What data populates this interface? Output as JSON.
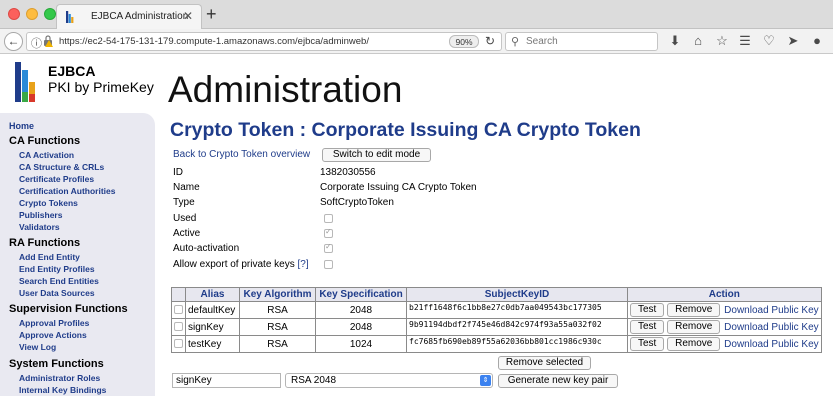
{
  "browser": {
    "tab_title": "EJBCA Administration",
    "tab_close": "✕",
    "new_tab": "+",
    "url": "https://ec2-54-175-131-179.compute-1.amazonaws.com/ejbca/adminweb/",
    "zoom": "90%",
    "search_placeholder": "Search"
  },
  "logo": {
    "title": "EJBCA",
    "subtitle": "PKI by PrimeKey"
  },
  "page_heading": "Administration",
  "sidebar": {
    "home": "Home",
    "sections": [
      {
        "title": "CA Functions",
        "items": [
          "CA Activation",
          "CA Structure & CRLs",
          "Certificate Profiles",
          "Certification Authorities",
          "Crypto Tokens",
          "Publishers",
          "Validators"
        ]
      },
      {
        "title": "RA Functions",
        "items": [
          "Add End Entity",
          "End Entity Profiles",
          "Search End Entities",
          "User Data Sources"
        ]
      },
      {
        "title": "Supervision Functions",
        "items": [
          "Approval Profiles",
          "Approve Actions",
          "View Log"
        ]
      },
      {
        "title": "System Functions",
        "items": [
          "Administrator Roles",
          "Internal Key Bindings"
        ]
      }
    ]
  },
  "crypto_token": {
    "title": "Crypto Token : Corporate Issuing CA Crypto Token",
    "back_link": "Back to Crypto Token overview",
    "edit_button": "Switch to edit mode",
    "fields": {
      "id_label": "ID",
      "id_value": "1382030556",
      "name_label": "Name",
      "name_value": "Corporate Issuing CA Crypto Token",
      "type_label": "Type",
      "type_value": "SoftCryptoToken",
      "used_label": "Used",
      "active_label": "Active",
      "autoactivation_label": "Auto-activation",
      "export_label": "Allow export of private keys",
      "export_help": "[?]"
    },
    "checkbox_states": {
      "used": false,
      "active": true,
      "auto_activation": true,
      "allow_export": false
    },
    "table": {
      "headers": {
        "alias": "Alias",
        "algorithm": "Key Algorithm",
        "spec": "Key Specification",
        "skid": "SubjectKeyID",
        "action": "Action"
      },
      "rows": [
        {
          "alias": "defaultKey",
          "algorithm": "RSA",
          "spec": "2048",
          "skid": "b21ff1648f6c1bb8e27c0db7aa049543bc177305",
          "test": "Test",
          "remove": "Remove",
          "download": "Download Public Key"
        },
        {
          "alias": "signKey",
          "algorithm": "RSA",
          "spec": "2048",
          "skid": "9b91194dbdf2f745e46d842c974f93a55a032f02",
          "test": "Test",
          "remove": "Remove",
          "download": "Download Public Key"
        },
        {
          "alias": "testKey",
          "algorithm": "RSA",
          "spec": "1024",
          "skid": "fc7685fb690eb89f55a62036bb801cc1986c930c",
          "test": "Test",
          "remove": "Remove",
          "download": "Download Public Key"
        }
      ]
    },
    "remove_selected": "Remove selected",
    "new_key_alias_value": "signKey",
    "new_key_spec_value": "RSA 2048",
    "generate_button": "Generate new key pair"
  }
}
